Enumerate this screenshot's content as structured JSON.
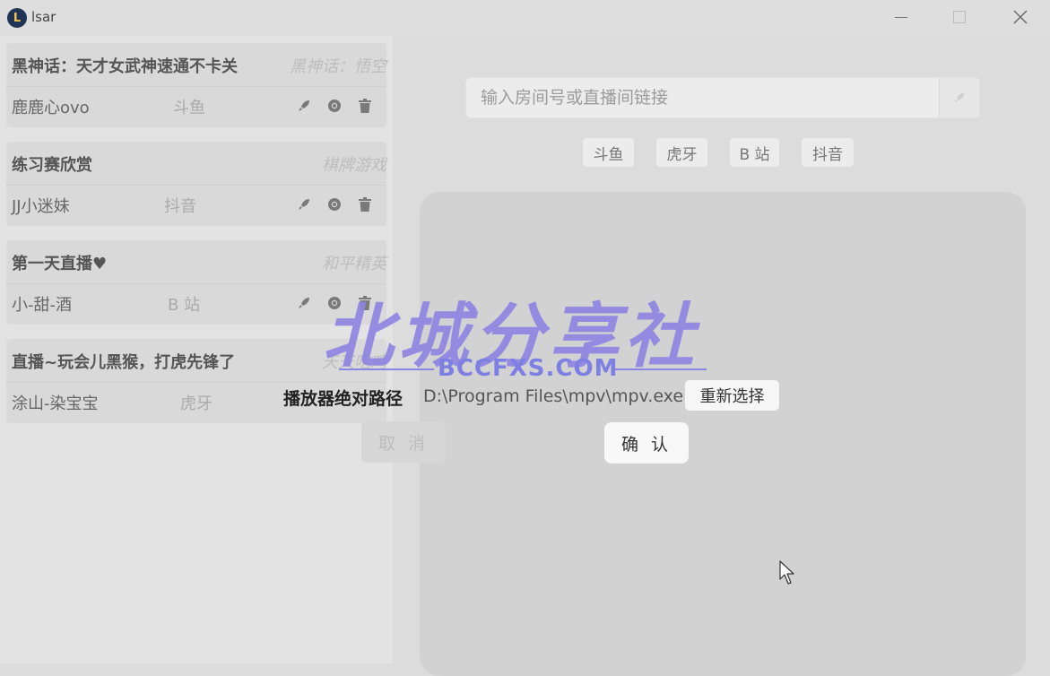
{
  "window": {
    "title": "lsar",
    "logo_glyph": "L"
  },
  "rooms": [
    {
      "title": "黑神话：天才女武神速通不卡关",
      "category": "黑神话：悟空",
      "anchor": "鹿鹿心ovo",
      "platform": "斗鱼"
    },
    {
      "title": "练习赛欣赏",
      "category": "棋牌游戏",
      "anchor": "JJ小迷妹",
      "platform": "抖音"
    },
    {
      "title": "第一天直播♥",
      "category": "和平精英",
      "anchor": "小-甜-酒",
      "platform": "B 站"
    },
    {
      "title": "直播~玩会儿黑猴，打虎先锋了",
      "category": "天天吃鸡",
      "anchor": "涂山-染宝宝",
      "platform": "虎牙"
    }
  ],
  "search": {
    "placeholder": "输入房间号或直播间链接"
  },
  "platforms": [
    "斗鱼",
    "虎牙",
    "B 站",
    "抖音"
  ],
  "dialog": {
    "label": "播放器绝对路径",
    "value": "D:\\Program Files\\mpv\\mpv.exe",
    "reselect": "重新选择",
    "confirm": "确 认",
    "cancel": "取 消"
  },
  "watermark": {
    "main": "北城分享社",
    "sub": "BCCFXS.COM"
  },
  "icons": [
    "rocket-icon",
    "chrome-icon",
    "trash-icon"
  ]
}
